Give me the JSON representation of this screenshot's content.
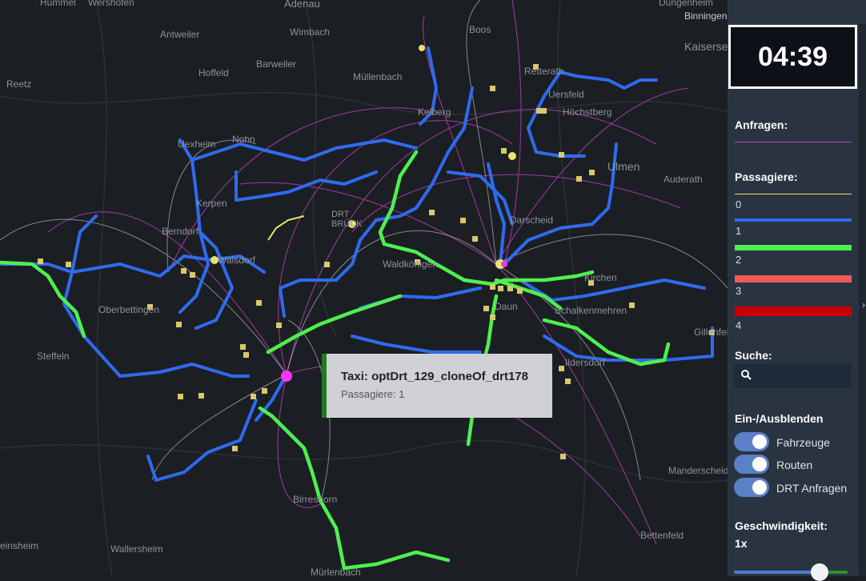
{
  "clock": "04:39",
  "map": {
    "places": [
      "Hummel",
      "Wershofen",
      "Adenau",
      "Dungenheim",
      "Binningen",
      "Kaiserse",
      "Antweiler",
      "Wimbach",
      "Boos",
      "Barweiler",
      "Hoffeld",
      "Müllenbach",
      "Reetz",
      "Retterath",
      "Uersfeld",
      "Höchstberg",
      "Uexheim",
      "Nohn",
      "Ulmen",
      "Auderath",
      "Kerpen",
      "DRT BRÜCK",
      "Berndorf",
      "Walsdorf",
      "Oberbettingen",
      "Kirchen",
      "Schalkenmehren",
      "Gillenfeld",
      "Steffeln",
      "Birresborn",
      "Bettenfeld",
      "einsheim",
      "Wallersheim",
      "Mürlenbach",
      "Manderscheid",
      "Waldkönigen",
      "Ildersdorf",
      "Kelberg",
      "Darscheid",
      "Daun"
    ],
    "tooltip": {
      "title": "Taxi: optDrt_129_cloneOf_drt178",
      "subtitle": "Passagiere: 1"
    }
  },
  "panel": {
    "requests_label": "Anfragen:",
    "passengers_label": "Passagiere:",
    "legend": [
      {
        "label": "0",
        "color": "#e8e36b"
      },
      {
        "label": "1",
        "color": "#2f6bf0"
      },
      {
        "label": "2",
        "color": "#4ef04e"
      },
      {
        "label": "3",
        "color": "#f05a5a"
      },
      {
        "label": "4",
        "color": "#c80000"
      }
    ],
    "request_color": "#c040c0",
    "search_label": "Suche:",
    "search_placeholder": "",
    "toggles_label": "Ein-/Ausblenden",
    "toggles": [
      {
        "label": "Fahrzeuge",
        "on": true
      },
      {
        "label": "Routen",
        "on": true
      },
      {
        "label": "DRT Anfragen",
        "on": true
      }
    ],
    "speed_label": "Geschwindigkeit:",
    "speed_value": "1x"
  }
}
